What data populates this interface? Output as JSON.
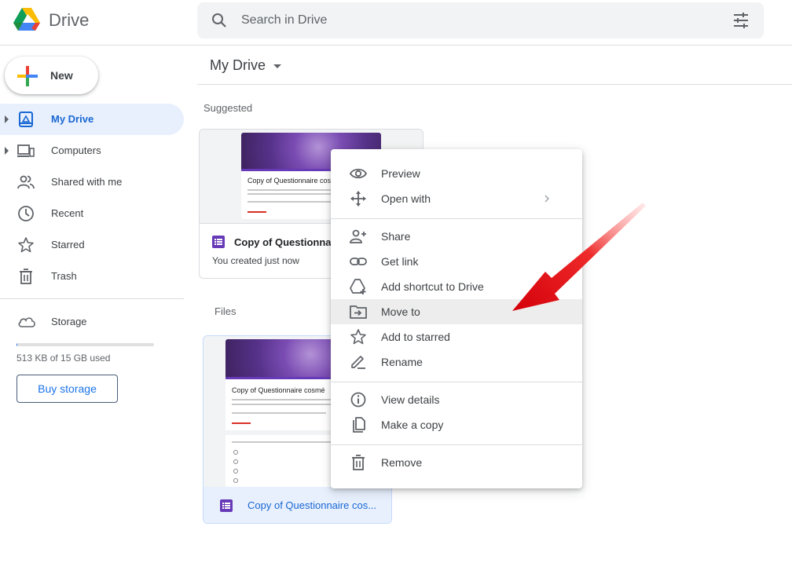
{
  "header": {
    "app_name": "Drive",
    "search_placeholder": "Search in Drive"
  },
  "sidebar": {
    "new_label": "New",
    "items": [
      {
        "label": "My Drive",
        "icon": "my-drive-icon",
        "active": true
      },
      {
        "label": "Computers",
        "icon": "computers-icon"
      },
      {
        "label": "Shared with me",
        "icon": "shared-icon"
      },
      {
        "label": "Recent",
        "icon": "clock-icon"
      },
      {
        "label": "Starred",
        "icon": "star-icon"
      },
      {
        "label": "Trash",
        "icon": "trash-icon"
      }
    ],
    "storage": {
      "label": "Storage",
      "used_text": "513 KB of 15 GB used",
      "used_fraction": 0.0003,
      "buy_label": "Buy storage"
    }
  },
  "main": {
    "title": "My Drive",
    "suggested_label": "Suggested",
    "files_label": "Files",
    "suggested_card": {
      "name": "Copy of Questionnair",
      "subtitle": "You created just now",
      "preview_title": "Copy of Questionnaire cos"
    },
    "file_card": {
      "name": "Copy of Questionnaire cos...",
      "preview_title": "Copy of Questionnaire cosmé"
    }
  },
  "context_menu": {
    "items": [
      {
        "label": "Preview",
        "icon": "eye-icon"
      },
      {
        "label": "Open with",
        "icon": "open-with-icon",
        "submenu": true
      },
      {
        "label": "Share",
        "icon": "share-person-icon"
      },
      {
        "label": "Get link",
        "icon": "link-icon"
      },
      {
        "label": "Add shortcut to Drive",
        "icon": "shortcut-icon"
      },
      {
        "label": "Move to",
        "icon": "move-folder-icon",
        "hovered": true
      },
      {
        "label": "Add to starred",
        "icon": "star-icon"
      },
      {
        "label": "Rename",
        "icon": "rename-icon"
      },
      {
        "label": "View details",
        "icon": "info-icon"
      },
      {
        "label": "Make a copy",
        "icon": "copy-icon"
      },
      {
        "label": "Remove",
        "icon": "trash-icon"
      }
    ]
  },
  "colors": {
    "accent": "#1a73e8",
    "active_bg": "#e8f0fe",
    "forms_purple": "#673ab7",
    "annotation_red": "#e0141e"
  }
}
